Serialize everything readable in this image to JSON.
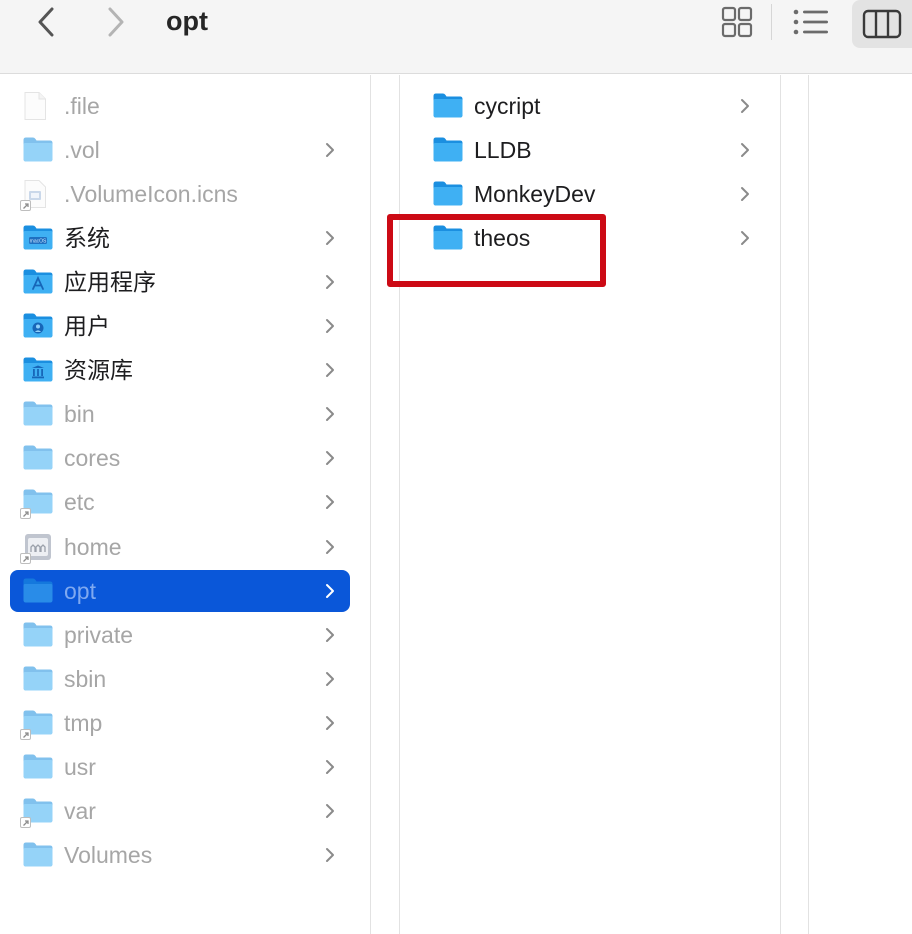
{
  "toolbar": {
    "title": "opt",
    "back_icon": "chevron-left-icon",
    "forward_icon": "chevron-right-icon",
    "views": [
      "icon-view-icon",
      "list-view-icon",
      "column-view-icon"
    ],
    "active_view": "column-view-icon"
  },
  "column1": {
    "items": [
      {
        "label": ".file",
        "icon": "document-icon",
        "dim": true,
        "chevron": false
      },
      {
        "label": ".vol",
        "icon": "folder-icon",
        "dim": true,
        "chevron": true
      },
      {
        "label": ".VolumeIcon.icns",
        "icon": "icns-file-icon",
        "dim": true,
        "chevron": false
      },
      {
        "label": "系统",
        "icon": "macos-folder-icon",
        "dim": false,
        "chevron": true
      },
      {
        "label": "应用程序",
        "icon": "applications-folder-icon",
        "dim": false,
        "chevron": true
      },
      {
        "label": "用户",
        "icon": "users-folder-icon",
        "dim": false,
        "chevron": true
      },
      {
        "label": "资源库",
        "icon": "library-folder-icon",
        "dim": false,
        "chevron": true
      },
      {
        "label": "bin",
        "icon": "folder-icon",
        "dim": true,
        "chevron": true
      },
      {
        "label": "cores",
        "icon": "folder-icon",
        "dim": true,
        "chevron": true
      },
      {
        "label": "etc",
        "icon": "folder-alias-icon",
        "dim": true,
        "chevron": true
      },
      {
        "label": "home",
        "icon": "network-home-icon",
        "dim": true,
        "chevron": true
      },
      {
        "label": "opt",
        "icon": "folder-icon",
        "dim": true,
        "chevron": true,
        "selected": true
      },
      {
        "label": "private",
        "icon": "folder-icon",
        "dim": true,
        "chevron": true
      },
      {
        "label": "sbin",
        "icon": "folder-icon",
        "dim": true,
        "chevron": true
      },
      {
        "label": "tmp",
        "icon": "folder-alias-icon",
        "dim": true,
        "chevron": true
      },
      {
        "label": "usr",
        "icon": "folder-icon",
        "dim": true,
        "chevron": true
      },
      {
        "label": "var",
        "icon": "folder-alias-icon",
        "dim": true,
        "chevron": true
      },
      {
        "label": "Volumes",
        "icon": "folder-icon",
        "dim": true,
        "chevron": true
      }
    ]
  },
  "column2": {
    "items": [
      {
        "label": "cycript",
        "icon": "folder-icon"
      },
      {
        "label": "LLDB",
        "icon": "folder-icon"
      },
      {
        "label": "MonkeyDev",
        "icon": "folder-icon"
      },
      {
        "label": "theos",
        "icon": "folder-icon",
        "highlighted": true
      }
    ]
  },
  "colors": {
    "selection": "#0a57d9",
    "highlight_box": "#cc0a15",
    "folder_blue": "#1e9be6"
  }
}
